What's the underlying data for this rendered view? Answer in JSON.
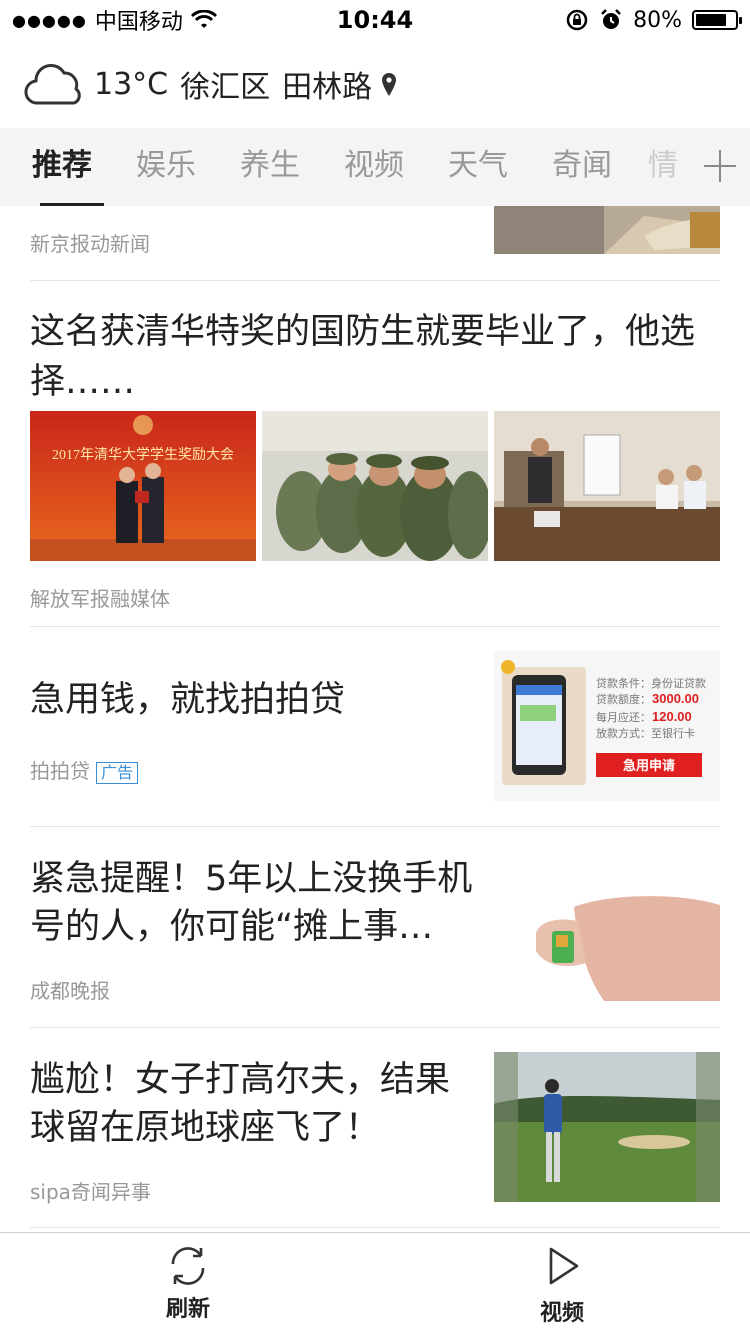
{
  "status_bar": {
    "carrier": "中国移动",
    "time": "10:44",
    "battery_percent": "80%",
    "battery_level": 0.8
  },
  "weather": {
    "temperature": "13°C",
    "district": "徐汇区",
    "road": "田林路",
    "icon": "cloud-icon"
  },
  "tabs": [
    {
      "label": "推荐",
      "active": true
    },
    {
      "label": "娱乐"
    },
    {
      "label": "养生"
    },
    {
      "label": "视频"
    },
    {
      "label": "天气"
    },
    {
      "label": "奇闻"
    },
    {
      "label": "情"
    }
  ],
  "feed": {
    "items": [
      {
        "source": "新京报动新闻"
      },
      {
        "title": "这名获清华特奖的国防生就要毕业了，他选择……",
        "source": "解放军报融媒体",
        "image_caption": "2017年清华大学学生奖励大会"
      },
      {
        "title": "急用钱，就找拍拍贷",
        "source": "拍拍贷",
        "ad_label": "广告",
        "ad_card": {
          "line1": "贷款条件：身份证贷款",
          "line2_label": "贷款额度：",
          "line2_value": "3000.00",
          "line3_label": "每月应还：",
          "line3_value": "120.00",
          "line4": "放款方式：至银行卡",
          "button": "急用申请"
        }
      },
      {
        "title": "紧急提醒！5年以上没换手机号的人，你可能“摊上事…",
        "source": "成都晚报"
      },
      {
        "title": "尴尬！女子打高尔夫，结果球留在原地球座飞了！",
        "source": "sipa奇闻异事"
      }
    ]
  },
  "bottom_bar": {
    "refresh_label": "刷新",
    "video_label": "视频"
  },
  "colors": {
    "tab_bar_bg": "#f4f4f4",
    "ad_badge": "#3a8fd6",
    "ad_button": "#e02020"
  }
}
